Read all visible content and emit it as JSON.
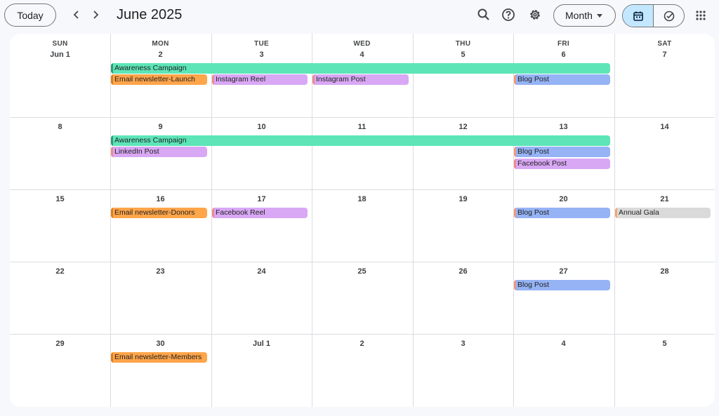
{
  "toolbar": {
    "today_label": "Today",
    "month_title": "June 2025",
    "view_label": "Month"
  },
  "icons": {
    "prev": "chevron-left-icon",
    "next": "chevron-right-icon",
    "search": "search-icon",
    "help": "help-icon",
    "settings": "gear-icon",
    "caret": "caret-down-icon",
    "calendar": "calendar-icon",
    "tasks": "tasks-check-icon",
    "apps": "apps-grid-icon"
  },
  "colors": {
    "awareness": "#5de5b8",
    "email": "#ffa54a",
    "social": "#d9a8f5",
    "blog": "#95b3f5",
    "gala": "#dadada",
    "selected_view": "#c2e7ff"
  },
  "weekdays": [
    "SUN",
    "MON",
    "TUE",
    "WED",
    "THU",
    "FRI",
    "SAT"
  ],
  "weeks": [
    [
      "Jun 1",
      "2",
      "3",
      "4",
      "5",
      "6",
      "7"
    ],
    [
      "8",
      "9",
      "10",
      "11",
      "12",
      "13",
      "14"
    ],
    [
      "15",
      "16",
      "17",
      "18",
      "19",
      "20",
      "21"
    ],
    [
      "22",
      "23",
      "24",
      "25",
      "26",
      "27",
      "28"
    ],
    [
      "29",
      "30",
      "Jul 1",
      "2",
      "3",
      "4",
      "5"
    ]
  ],
  "events": {
    "w1_awareness": "Awareness Campaign",
    "w1_email": "Email newsletter-Launch",
    "w1_insta_reel": "Instagram Reel",
    "w1_insta_post": "Instagram Post",
    "w1_blog": "Blog Post",
    "w2_awareness": "Awareness Campaign",
    "w2_linkedin": "LinkedIn Post",
    "w2_blog": "Blog Post",
    "w2_facebook": "Facebook Post",
    "w3_email": "Email newsletter-Donors",
    "w3_fb_reel": "Facebook Reel",
    "w3_blog": "Blog Post",
    "w3_gala": "Annual Gala",
    "w4_blog": "Blog Post",
    "w5_email": "Email newsletter-Members"
  }
}
